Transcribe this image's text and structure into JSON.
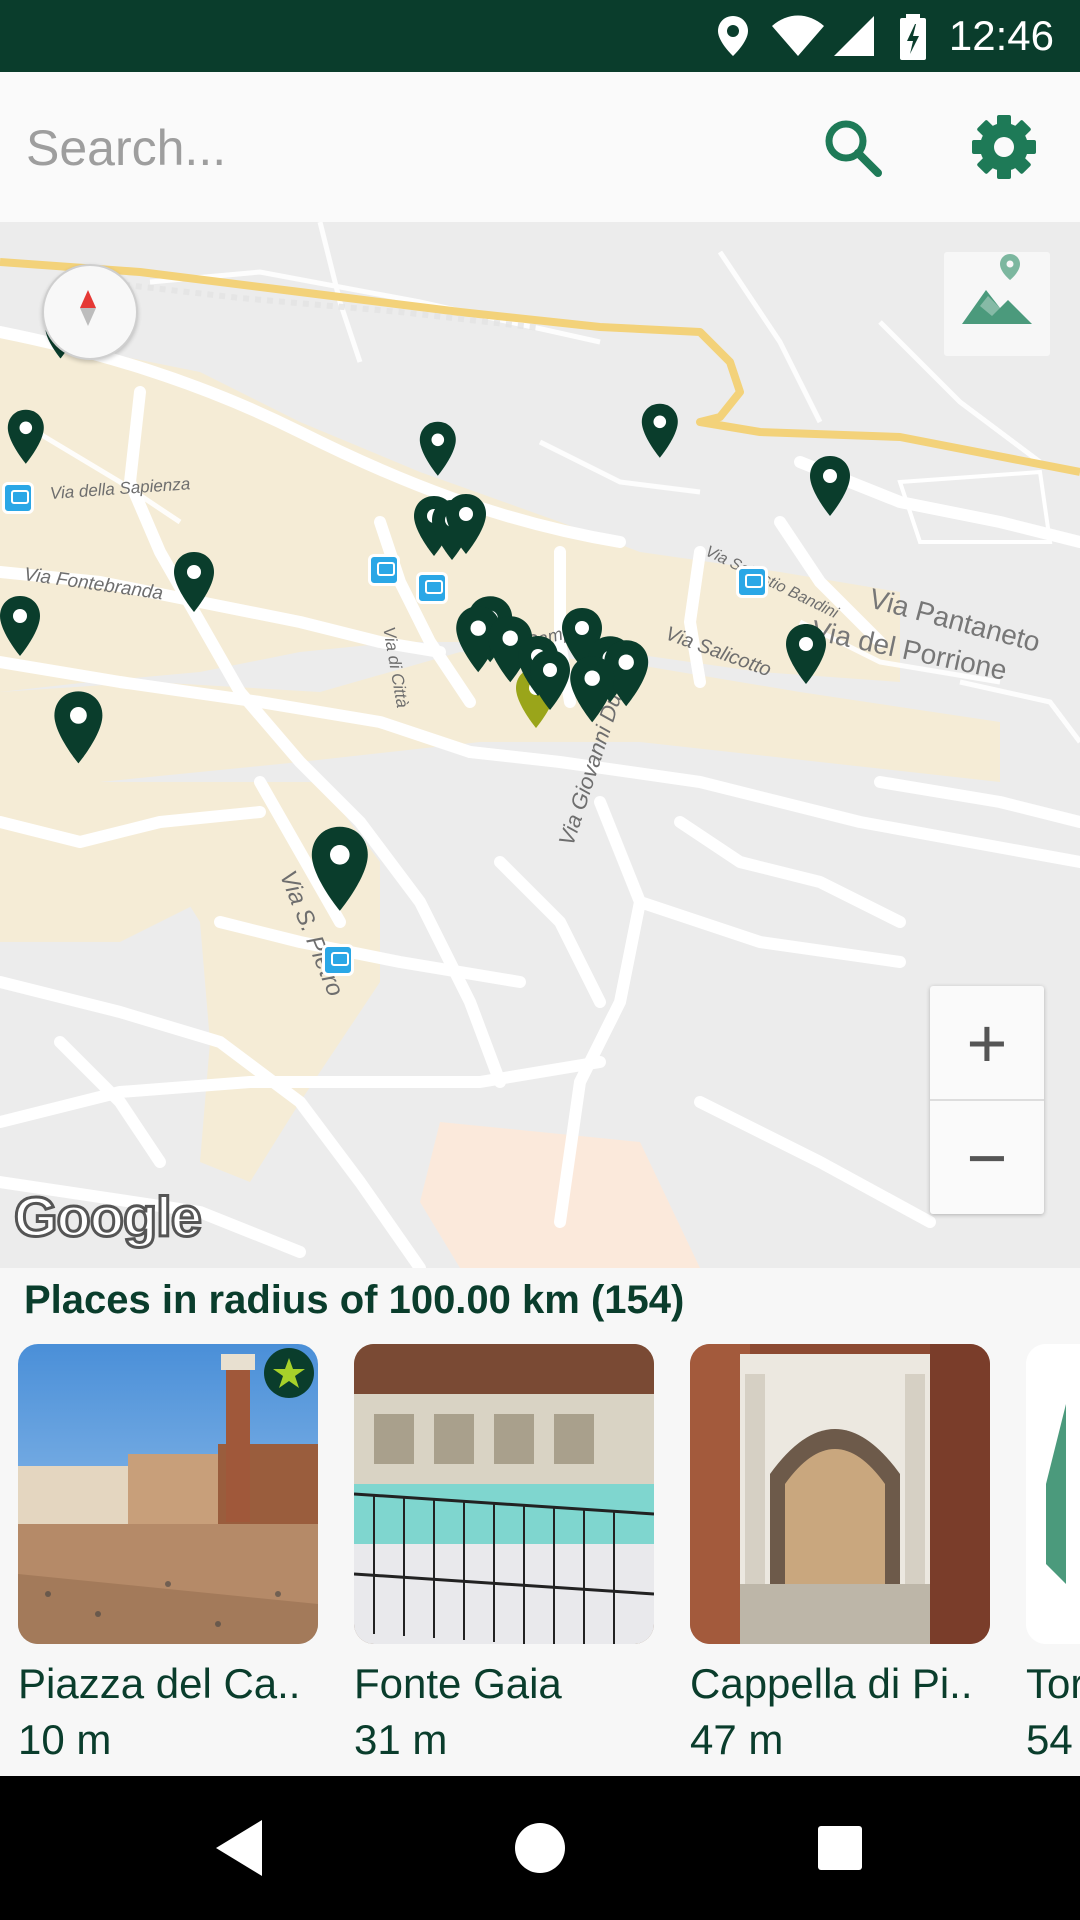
{
  "status_bar": {
    "time": "12:46",
    "icons": [
      "location-icon",
      "wifi-icon",
      "signal-icon",
      "battery-charging-icon"
    ]
  },
  "search": {
    "placeholder": "Search...",
    "search_icon": "search-icon",
    "settings_icon": "gear-icon"
  },
  "map": {
    "street_labels": [
      "Via della Sapienza",
      "Via Fontebranda",
      "Via di Città",
      "Il Campo",
      "Via Salicotto",
      "Via Giovanni Duprè",
      "Via S. Pietro",
      "Via Pantaneto",
      "Via del Porrione",
      "Via Sallustio Bandini"
    ],
    "logo_text": "Google",
    "zoom_in_label": "+",
    "zoom_out_label": "−",
    "compass_icon": "compass-icon",
    "map_type_icon": "terrain-icon",
    "colors": {
      "pin": "#0a3d2c",
      "pin_highlight": "#9aa51a",
      "road_major": "#f3d27a",
      "bus_stop": "#2aa7e6"
    }
  },
  "places": {
    "heading": "Places in radius of 100.00 km (154)",
    "items": [
      {
        "name": "Piazza del Ca..",
        "distance": "10 m",
        "favorite": true
      },
      {
        "name": "Fonte Gaia",
        "distance": "31 m",
        "favorite": false
      },
      {
        "name": "Cappella di Pi..",
        "distance": "47 m",
        "favorite": false
      },
      {
        "name": "Tor",
        "distance": "54",
        "favorite": false
      }
    ]
  },
  "nav_bar": {
    "back_icon": "back-icon",
    "home_icon": "home-icon",
    "recents_icon": "recents-icon"
  }
}
